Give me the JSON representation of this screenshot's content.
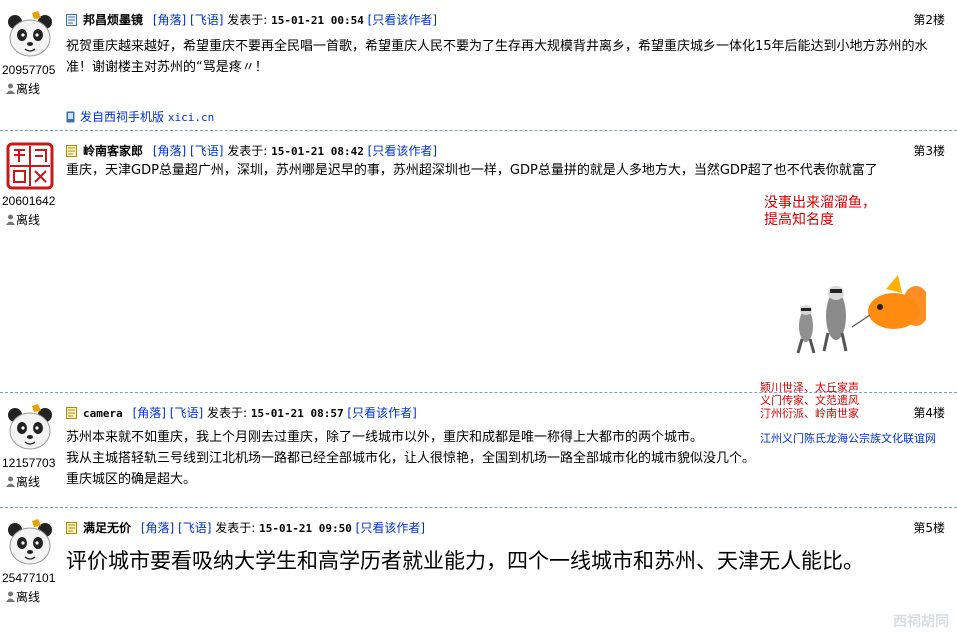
{
  "labels": {
    "corner": "[角落]",
    "feiyu": "[飞语]",
    "posted_at": "发表于:",
    "only_author": "[只看该作者]",
    "offline": "离线"
  },
  "posts": [
    {
      "username": "邦昌烦墨镜",
      "uid": "20957705",
      "time": "15-01-21 00:54",
      "floor": "第2楼",
      "content": "祝贺重庆越来越好，希望重庆不要再全民唱一首歌，希望重庆人民不要为了生存再大规模背井离乡，希望重庆城乡一体化15年后能达到小地方苏州的水准！谢谢楼主对苏州的“骂是疼〃！",
      "mobile_text": "发自西祠手机版",
      "mobile_domain": "xici.cn"
    },
    {
      "username": "岭南客家郎",
      "uid": "20601642",
      "time": "15-01-21 08:42",
      "floor": "第3楼",
      "content": "重庆，天津GDP总量超广州，深圳，苏州哪是迟早的事，苏州超深圳也一样，GDP总量拼的就是人多地方大，当然GDP超了也不代表你就富了",
      "signature": {
        "line1": "没事出来溜溜鱼，",
        "line2": "提高知名度",
        "mottos": [
          "颍川世泽、太丘家声",
          "义门传家、文范遗风",
          "汀州衍派、岭南世家"
        ],
        "link": "江州义门陈氏龙海公宗族文化联谊网"
      }
    },
    {
      "username": "camera",
      "uid": "12157703",
      "time": "15-01-21 08:57",
      "floor": "第4楼",
      "lines": [
        "苏州本来就不如重庆，我上个月刚去过重庆，除了一线城市以外，重庆和成都是唯一称得上大都市的两个城市。",
        "我从主城搭轻轨三号线到江北机场一路都已经全部城市化，让人很惊艳，全国到机场一路全部城市化的城市貌似没几个。",
        "重庆城区的确是超大。"
      ]
    },
    {
      "username": "满足无价",
      "uid": "25477101",
      "time": "15-01-21 09:50",
      "floor": "第5楼",
      "content": "评价城市要看吸纳大学生和高学历者就业能力，四个一线城市和苏州、天津无人能比。"
    }
  ],
  "watermark": "西祠胡同"
}
